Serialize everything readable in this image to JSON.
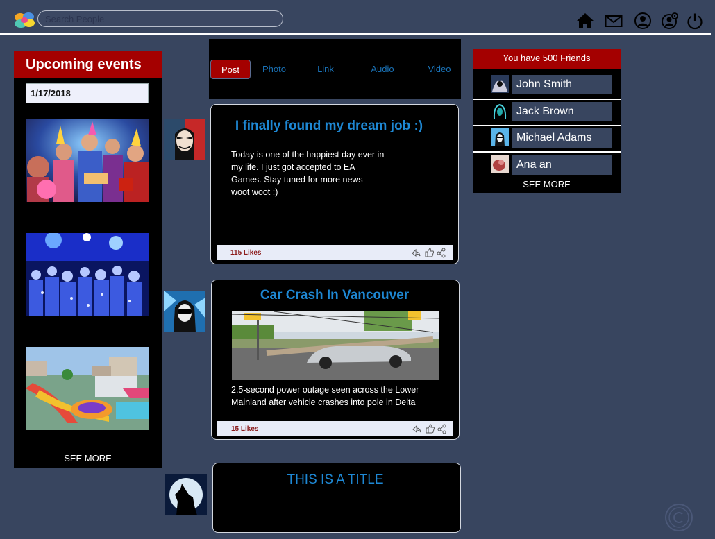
{
  "header": {
    "search_placeholder": "Search People",
    "icons": [
      "home-icon",
      "mail-icon",
      "user-icon",
      "account-settings-icon",
      "power-icon"
    ]
  },
  "events": {
    "title": "Upcoming events",
    "date": "1/17/2018",
    "see_more": "SEE MORE",
    "images": [
      "party-photo",
      "nightclub-photo",
      "waterpark-photo"
    ]
  },
  "tabs": [
    {
      "label": "Post",
      "active": true
    },
    {
      "label": "Photo",
      "active": false
    },
    {
      "label": "Link",
      "active": false
    },
    {
      "label": "Audio",
      "active": false
    },
    {
      "label": "Video",
      "active": false
    }
  ],
  "posts": [
    {
      "title": "I finally found my dream job :)",
      "body_lines": [
        "Today is one of the happiest day ever in",
        "my life. I just got accepted to EA",
        "Games. Stay tuned for more news",
        "woot woot :)"
      ],
      "likes": "115 Likes"
    },
    {
      "title": "Car Crash In Vancouver",
      "body_lines": [
        "2.5-second power outage seen across the Lower",
        "Mainland after vehicle crashes into pole in Delta"
      ],
      "likes": "15 Likes"
    },
    {
      "title": "THIS IS A TITLE"
    }
  ],
  "friends": {
    "header": "You have 500 Friends",
    "list": [
      {
        "name": "John Smith"
      },
      {
        "name": "Jack Brown"
      },
      {
        "name": "Michael Adams"
      },
      {
        "name": "Ana an"
      }
    ],
    "see_more": "SEE MORE"
  },
  "colors": {
    "background": "#38455f",
    "accent_red": "#a40000",
    "link_blue": "#1e88d4",
    "panel": "#000000"
  }
}
